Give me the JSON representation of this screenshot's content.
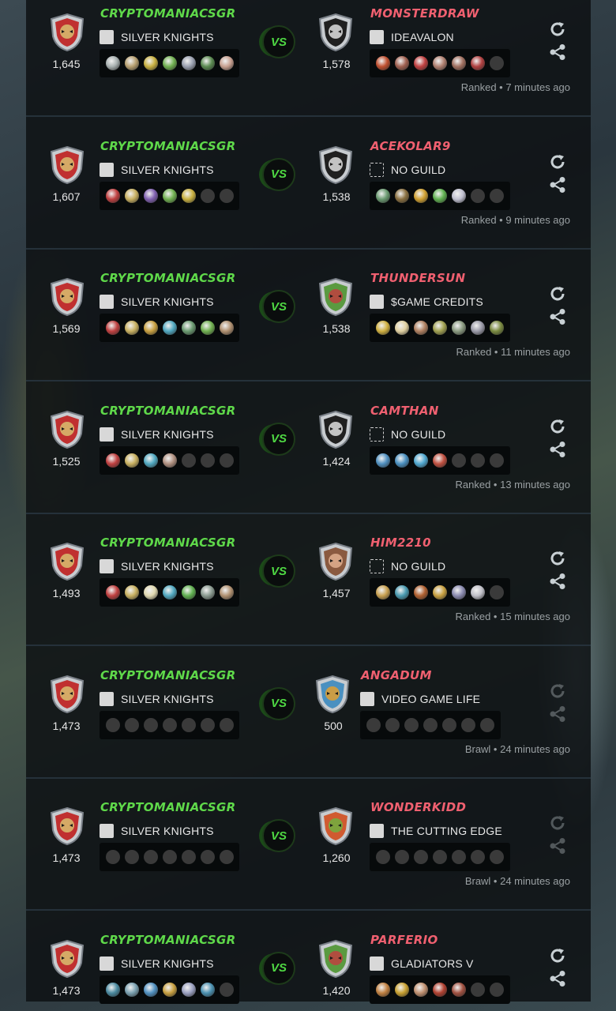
{
  "colors": {
    "left_name": "#5fd94a",
    "right_name": "#f06070",
    "vs": "#4fd843",
    "panel": "#0e1214"
  },
  "battles": [
    {
      "left": {
        "name": "CRYPTOMANIACSGR",
        "guild": "SILVER KNIGHTS",
        "rating": "1,645",
        "cards": [
          "#a8b0b0",
          "#b8a070",
          "#c8b040",
          "#70b050",
          "#9aa0b0",
          "#5a8a50",
          "#c8a090"
        ]
      },
      "right": {
        "name": "MONSTERDRAW",
        "guild": "IDEAVALON",
        "rating": "1,578",
        "avatar": "monster",
        "guild_icon": "solid",
        "cards": [
          "#c05030",
          "#a06050",
          "#c04040",
          "#b08070",
          "#a07060",
          "#b04040",
          null
        ]
      },
      "status": "Ranked • 7 minutes ago",
      "actions_dim": false
    },
    {
      "left": {
        "name": "CRYPTOMANIACSGR",
        "guild": "SILVER KNIGHTS",
        "rating": "1,607",
        "cards": [
          "#c04040",
          "#c8b060",
          "#8060b0",
          "#70b050",
          "#c8b040",
          null,
          null
        ]
      },
      "right": {
        "name": "ACEKOLAR9",
        "guild": "NO GUILD",
        "rating": "1,538",
        "avatar": "monster",
        "guild_icon": "dashed",
        "cards": [
          "#6a9a70",
          "#8a7040",
          "#d0a030",
          "#60b050",
          "#c0c0d0",
          null,
          null
        ]
      },
      "status": "Ranked • 9 minutes ago",
      "actions_dim": false
    },
    {
      "left": {
        "name": "CRYPTOMANIACSGR",
        "guild": "SILVER KNIGHTS",
        "rating": "1,569",
        "cards": [
          "#c04040",
          "#c8b060",
          "#c8a040",
          "#50a8c0",
          "#6a9a70",
          "#70b050",
          "#b09070"
        ]
      },
      "right": {
        "name": "THUNDERSUN",
        "guild": "$GAME CREDITS",
        "rating": "1,538",
        "avatar": "goblin",
        "guild_icon": "solid",
        "cards": [
          "#d0b040",
          "#e0d0a0",
          "#b08060",
          "#a0a050",
          "#8a9a80",
          "#9a9aa8",
          "#7a8a40"
        ]
      },
      "status": "Ranked • 11 minutes ago",
      "actions_dim": false
    },
    {
      "left": {
        "name": "CRYPTOMANIACSGR",
        "guild": "SILVER KNIGHTS",
        "rating": "1,525",
        "cards": [
          "#c04040",
          "#c8b060",
          "#50a8c0",
          "#b09080",
          null,
          null,
          null
        ]
      },
      "right": {
        "name": "CAMTHAN",
        "guild": "NO GUILD",
        "rating": "1,424",
        "avatar": "monster",
        "guild_icon": "dashed",
        "cards": [
          "#5090c0",
          "#4a90c0",
          "#50a8d0",
          "#c05040",
          null,
          null,
          null
        ]
      },
      "status": "Ranked • 13 minutes ago",
      "actions_dim": false
    },
    {
      "left": {
        "name": "CRYPTOMANIACSGR",
        "guild": "SILVER KNIGHTS",
        "rating": "1,493",
        "cards": [
          "#c04040",
          "#c8b060",
          "#e0d8b0",
          "#50a8c0",
          "#60b050",
          "#8a9a90",
          "#b09070"
        ]
      },
      "right": {
        "name": "HIM2210",
        "guild": "NO GUILD",
        "rating": "1,457",
        "avatar": "human",
        "guild_icon": "dashed",
        "cards": [
          "#c8a050",
          "#4a9ab0",
          "#b06030",
          "#c8a040",
          "#8a8ab0",
          "#c0c0c8",
          null
        ]
      },
      "status": "Ranked • 15 minutes ago",
      "actions_dim": false
    },
    {
      "left": {
        "name": "CRYPTOMANIACSGR",
        "guild": "SILVER KNIGHTS",
        "rating": "1,473",
        "cards": [
          null,
          null,
          null,
          null,
          null,
          null,
          null
        ]
      },
      "right": {
        "name": "ANGADUM",
        "guild": "VIDEO GAME LIFE",
        "rating": "500",
        "avatar": "bird",
        "guild_icon": "solid",
        "cards": [
          null,
          null,
          null,
          null,
          null,
          null,
          null
        ]
      },
      "status": "Brawl • 24 minutes ago",
      "actions_dim": true
    },
    {
      "left": {
        "name": "CRYPTOMANIACSGR",
        "guild": "SILVER KNIGHTS",
        "rating": "1,473",
        "cards": [
          null,
          null,
          null,
          null,
          null,
          null,
          null
        ]
      },
      "right": {
        "name": "WONDERKIDD",
        "guild": "THE CUTTING EDGE",
        "rating": "1,260",
        "avatar": "frog",
        "guild_icon": "solid",
        "cards": [
          null,
          null,
          null,
          null,
          null,
          null,
          null
        ]
      },
      "status": "Brawl • 24 minutes ago",
      "actions_dim": true
    },
    {
      "left": {
        "name": "CRYPTOMANIACSGR",
        "guild": "SILVER KNIGHTS",
        "rating": "1,473",
        "cards": [
          "#4a8aa0",
          "#7aa0b0",
          "#5090c0",
          "#c8a040",
          "#9aa0c0",
          "#4a90b0",
          null
        ]
      },
      "right": {
        "name": "PARFERIO",
        "guild": "GLADIATORS V",
        "rating": "1,420",
        "avatar": "goblin",
        "guild_icon": "solid",
        "cards": [
          "#c08040",
          "#c8a030",
          "#c09070",
          "#b04030",
          "#a05040",
          null,
          null
        ]
      },
      "status": "",
      "actions_dim": false
    }
  ],
  "vs_label": "VS"
}
